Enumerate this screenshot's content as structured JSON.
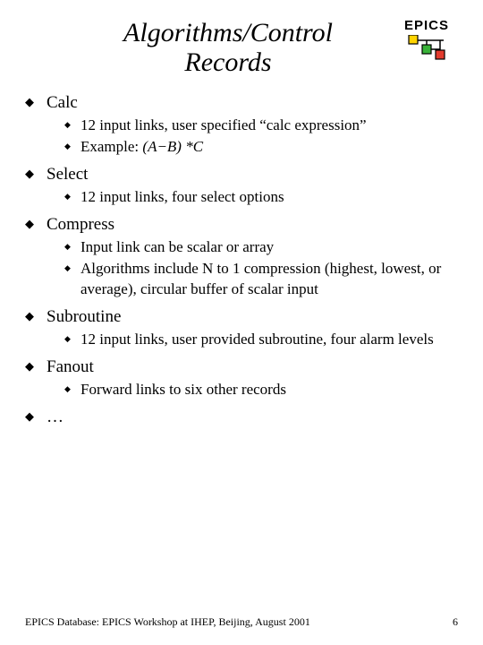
{
  "logo": {
    "text": "EPICS"
  },
  "title": {
    "line1": "Algorithms/Control",
    "line2": "Records"
  },
  "sections": {
    "calc": {
      "heading": "Calc",
      "items": [
        "12 input links, user specified “calc expression”",
        "Example:  "
      ],
      "example_expr": "(A−B) *C"
    },
    "select": {
      "heading": "Select",
      "items": [
        "12 input links, four select options"
      ]
    },
    "compress": {
      "heading": "Compress",
      "items": [
        "Input link can be scalar or array",
        "Algorithms include N to 1 compression (highest, lowest, or average), circular buffer of scalar input"
      ]
    },
    "subroutine": {
      "heading": "Subroutine",
      "items": [
        "12 input links, user provided subroutine, four alarm levels"
      ]
    },
    "fanout": {
      "heading": "Fanout",
      "items": [
        "Forward links to six other records"
      ]
    },
    "more": {
      "heading": "…"
    }
  },
  "footer": {
    "left": "EPICS Database: EPICS Workshop at IHEP, Beijing, August 2001",
    "right": "6"
  }
}
